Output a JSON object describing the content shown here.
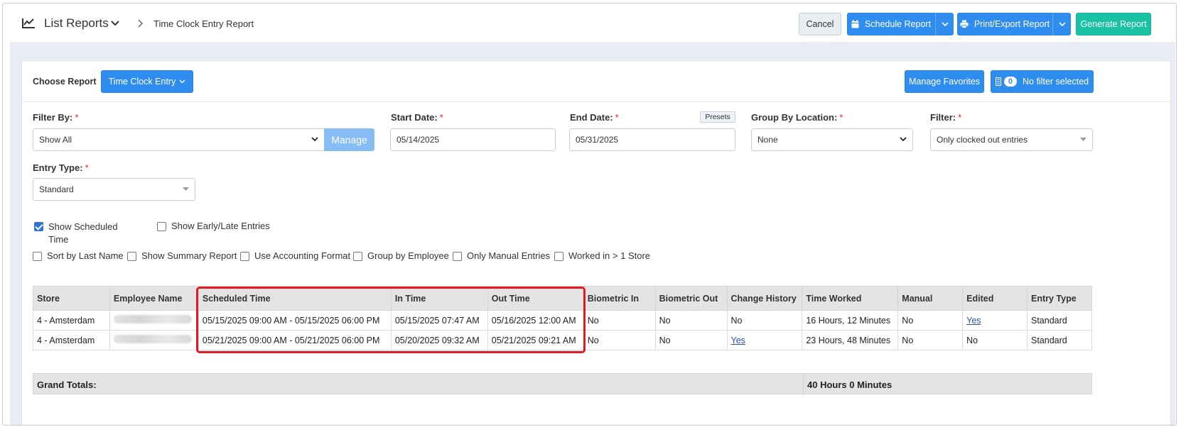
{
  "header": {
    "breadcrumb_root": "List Reports",
    "breadcrumb_current": "Time Clock Entry Report",
    "cancel_label": "Cancel",
    "schedule_label": "Schedule Report",
    "print_label": "Print/Export Report",
    "generate_label": "Generate Report"
  },
  "toolbar": {
    "choose_label": "Choose Report",
    "report_selected": "Time Clock Entry",
    "manage_favorites": "Manage Favorites",
    "filter_count": "0",
    "filter_label": "No filter selected"
  },
  "form": {
    "filter_by_label": "Filter By:",
    "filter_by_value": "Show All",
    "manage_label": "Manage",
    "start_label": "Start Date:",
    "start_value": "05/14/2025",
    "end_label": "End Date:",
    "end_value": "05/31/2025",
    "presets_label": "Presets",
    "group_label": "Group By Location:",
    "group_value": "None",
    "filter_label": "Filter:",
    "filter_value": "Only clocked out entries",
    "entry_type_label": "Entry Type:",
    "entry_type_value": "Standard",
    "required_mark": "*"
  },
  "options": {
    "show_scheduled_1": "Show Scheduled",
    "show_scheduled_2": "Time",
    "show_early_late": "Show Early/Late Entries",
    "sort_last": "Sort by Last Name",
    "show_summary": "Show Summary Report",
    "accounting": "Use Accounting Format",
    "group_employee": "Group by Employee",
    "manual_only": "Only Manual Entries",
    "worked_multi": "Worked in > 1 Store"
  },
  "table": {
    "columns": [
      "Store",
      "Employee Name",
      "Scheduled Time",
      "In Time",
      "Out Time",
      "Biometric In",
      "Biometric Out",
      "Change History",
      "Time Worked",
      "Manual",
      "Edited",
      "Entry Type"
    ],
    "rows": [
      {
        "store": "4 - Amsterdam",
        "scheduled": "05/15/2025 09:00 AM - 05/15/2025 06:00 PM",
        "in": "05/15/2025 07:47 AM",
        "out": "05/16/2025 12:00 AM",
        "bio_in": "No",
        "bio_out": "No",
        "history": "No",
        "worked": "16 Hours, 12 Minutes",
        "manual": "No",
        "edited": "Yes",
        "type": "Standard"
      },
      {
        "store": "4 - Amsterdam",
        "scheduled": "05/21/2025 09:00 AM - 05/21/2025 06:00 PM",
        "in": "05/20/2025 09:32 AM",
        "out": "05/21/2025 09:21 AM",
        "bio_in": "No",
        "bio_out": "No",
        "history": "Yes",
        "worked": "23 Hours, 48 Minutes",
        "manual": "No",
        "edited": "No",
        "type": "Standard"
      }
    ]
  },
  "totals": {
    "label": "Grand Totals:",
    "value": "40 Hours 0 Minutes"
  }
}
